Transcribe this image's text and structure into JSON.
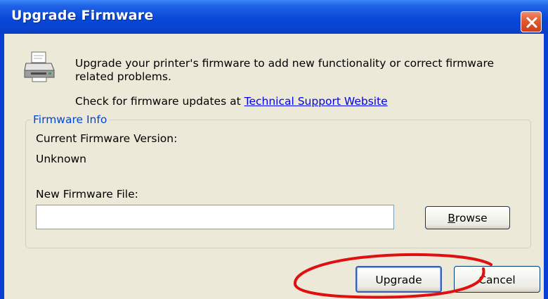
{
  "window": {
    "title": "Upgrade Firmware"
  },
  "intro": {
    "description": "Upgrade your printer's firmware to add new functionality or correct firmware related problems.",
    "check_text": "Check for firmware updates at ",
    "support_link": "Technical Support Website"
  },
  "firmware_info": {
    "legend": "Firmware Info",
    "current_version_label": "Current Firmware Version:",
    "current_version_value": "Unknown",
    "new_file_label": "New Firmware File:",
    "new_file_value": "",
    "browse_label_first": "B",
    "browse_label_rest": "rowse"
  },
  "actions": {
    "upgrade_label": "Upgrade",
    "cancel_label": "Cancel"
  },
  "icons": {
    "close": "close-icon",
    "printer": "printer-icon"
  },
  "colors": {
    "titlebar": "#0a43cf",
    "client_bg": "#ece9d8",
    "close_button": "#e05a31",
    "legend_text": "#0046d5",
    "link": "#0000ee",
    "annotation": "#e01010"
  }
}
